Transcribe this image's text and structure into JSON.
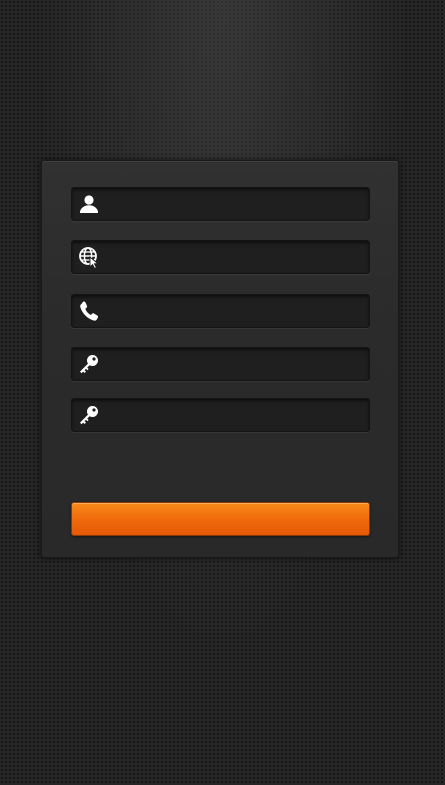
{
  "form": {
    "fields": [
      {
        "icon": "user-icon",
        "value": "",
        "placeholder": ""
      },
      {
        "icon": "globe-cursor-icon",
        "value": "",
        "placeholder": ""
      },
      {
        "icon": "phone-icon",
        "value": "",
        "placeholder": ""
      },
      {
        "icon": "key-icon",
        "value": "",
        "placeholder": ""
      },
      {
        "icon": "key-icon",
        "value": "",
        "placeholder": ""
      }
    ],
    "submit_label": ""
  },
  "colors": {
    "background": "#262626",
    "panel": "#2d2d2d",
    "field": "#1f1f1f",
    "icon": "#ffffff",
    "accent": "#f06a0c"
  }
}
